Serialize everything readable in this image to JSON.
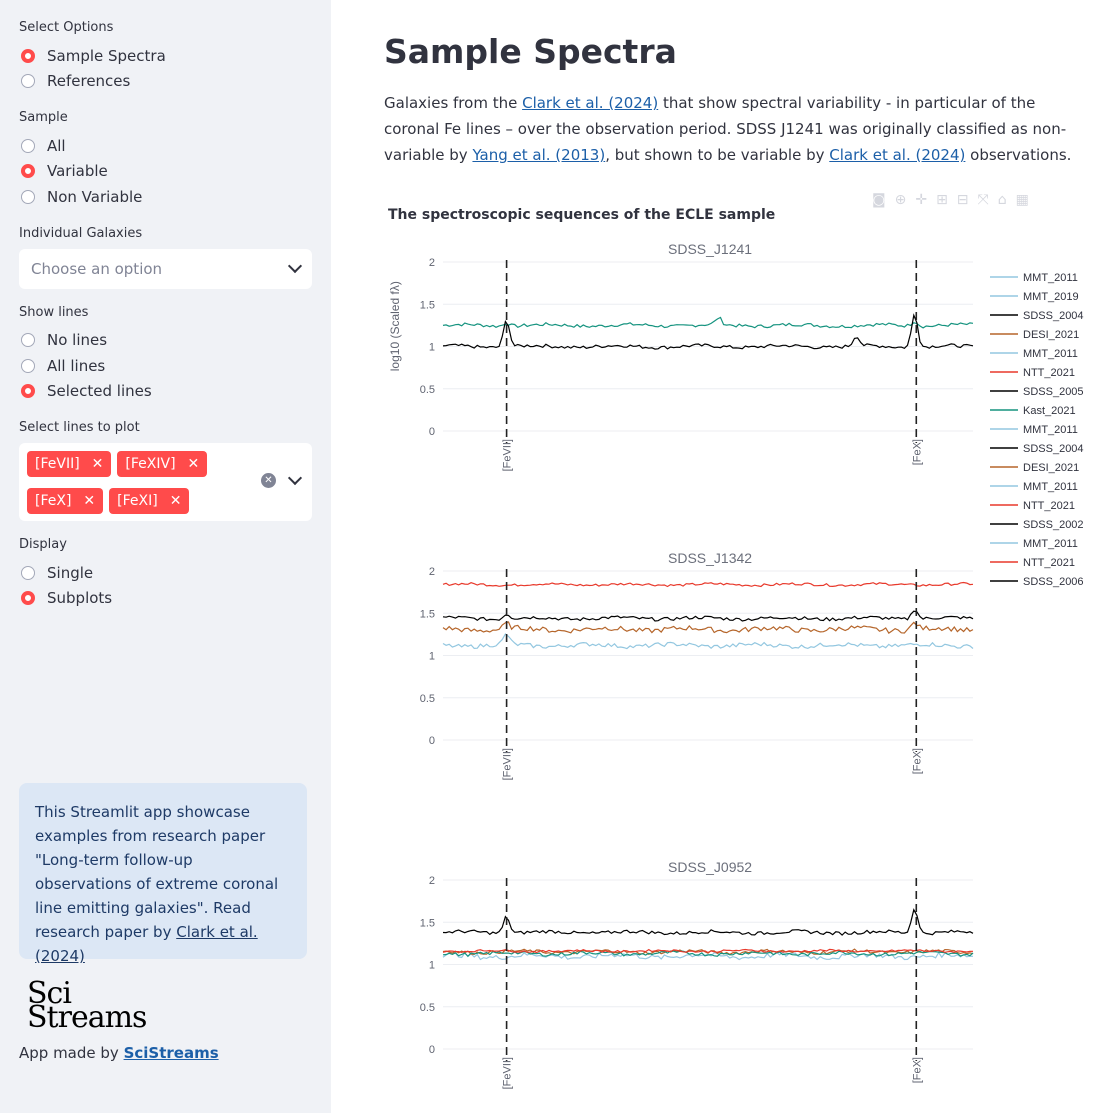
{
  "sidebar": {
    "select_options": {
      "label": "Select Options",
      "options": [
        "Sample Spectra",
        "References"
      ],
      "selected": 0
    },
    "sample": {
      "label": "Sample",
      "options": [
        "All",
        "Variable",
        "Non Variable"
      ],
      "selected": 1
    },
    "individual": {
      "label": "Individual Galaxies",
      "placeholder": "Choose an option"
    },
    "show_lines": {
      "label": "Show lines",
      "options": [
        "No lines",
        "All lines",
        "Selected lines"
      ],
      "selected": 2
    },
    "select_lines": {
      "label": "Select lines to plot",
      "tags": [
        "[FeVII]",
        "[FeXIV]",
        "[FeX]",
        "[FeXI]"
      ]
    },
    "display": {
      "label": "Display",
      "options": [
        "Single",
        "Subplots"
      ],
      "selected": 1
    },
    "info": {
      "text": "This Streamlit app showcase examples from research paper \"Long-term follow-up observations of extreme coronal line emitting galaxies\". Read research paper by ",
      "link": "Clark et al. (2024)"
    },
    "logo": {
      "line1": "Sci",
      "line2": "Streams"
    },
    "made_by": {
      "text": "App made by ",
      "link": "SciStreams"
    }
  },
  "main": {
    "title": "Sample Spectra",
    "desc_1": "Galaxies from the ",
    "link_1": "Clark et al. (2024)",
    "desc_2": " that show spectral variability - in particular of the coronal Fe lines – over the observation period. SDSS J1241 was originally classified as non-variable by ",
    "link_2": "Yang et al. (2013)",
    "desc_3": ", but shown to be variable by ",
    "link_3": "Clark et al. (2024)",
    "desc_4": " observations."
  },
  "colors": {
    "accent": "#ff4b4b",
    "sidebar_bg": "#f0f2f6",
    "info_bg": "#dce7f5"
  },
  "chart_data": {
    "type": "line",
    "title": "The spectroscopic sequences of the ECLE sample",
    "ylabel": "log10 (Scaled fλ)",
    "ylim": [
      0,
      2
    ],
    "yticks": [
      "2",
      "1.5",
      "1",
      "0.5",
      "0"
    ],
    "line_markers": [
      "[FeVII]",
      "[FeX]"
    ],
    "legend": [
      {
        "name": "MMT_2011",
        "color": "#93c7e0"
      },
      {
        "name": "MMT_2019",
        "color": "#93c7e0"
      },
      {
        "name": "SDSS_2004",
        "color": "#000000"
      },
      {
        "name": "DESI_2021",
        "color": "#b5652a"
      },
      {
        "name": "MMT_2011",
        "color": "#93c7e0"
      },
      {
        "name": "NTT_2021",
        "color": "#e8392b"
      },
      {
        "name": "SDSS_2005",
        "color": "#000000"
      },
      {
        "name": "Kast_2021",
        "color": "#15937f"
      },
      {
        "name": "MMT_2011",
        "color": "#93c7e0"
      },
      {
        "name": "SDSS_2004",
        "color": "#000000"
      },
      {
        "name": "DESI_2021",
        "color": "#b5652a"
      },
      {
        "name": "MMT_2011",
        "color": "#93c7e0"
      },
      {
        "name": "NTT_2021",
        "color": "#e8392b"
      },
      {
        "name": "SDSS_2002",
        "color": "#000000"
      },
      {
        "name": "MMT_2011",
        "color": "#93c7e0"
      },
      {
        "name": "NTT_2021",
        "color": "#e8392b"
      },
      {
        "name": "SDSS_2006",
        "color": "#000000"
      }
    ],
    "subplots": [
      {
        "title": "SDSS_J1241",
        "series": [
          {
            "color": "#15937f",
            "base": 1.25,
            "noise": 0.02,
            "peaks": [
              [
                0.52,
                0.08
              ],
              [
                0.12,
                0.04
              ],
              [
                0.89,
                0.06
              ]
            ]
          },
          {
            "color": "#000000",
            "base": 1.0,
            "noise": 0.02,
            "peaks": [
              [
                0.12,
                0.32
              ],
              [
                0.89,
                0.4
              ],
              [
                0.78,
                0.12
              ]
            ]
          }
        ]
      },
      {
        "title": "SDSS_J1342",
        "series": [
          {
            "color": "#e8392b",
            "base": 1.84,
            "noise": 0.015,
            "peaks": []
          },
          {
            "color": "#000000",
            "base": 1.44,
            "noise": 0.02,
            "peaks": [
              [
                0.12,
                0.06
              ],
              [
                0.89,
                0.12
              ]
            ]
          },
          {
            "color": "#b5652a",
            "base": 1.31,
            "noise": 0.03,
            "peaks": [
              [
                0.12,
                0.06
              ],
              [
                0.89,
                0.08
              ]
            ]
          },
          {
            "color": "#93c7e0",
            "base": 1.12,
            "noise": 0.025,
            "peaks": [
              [
                0.12,
                0.12
              ]
            ]
          }
        ]
      },
      {
        "title": "SDSS_J0952",
        "series": [
          {
            "color": "#000000",
            "base": 1.38,
            "noise": 0.02,
            "peaks": [
              [
                0.12,
                0.2
              ],
              [
                0.89,
                0.3
              ]
            ]
          },
          {
            "color": "#93c7e0",
            "base": 1.1,
            "noise": 0.03,
            "peaks": []
          },
          {
            "color": "#b5652a",
            "base": 1.15,
            "noise": 0.02,
            "peaks": []
          },
          {
            "color": "#15937f",
            "base": 1.13,
            "noise": 0.02,
            "peaks": []
          },
          {
            "color": "#e8392b",
            "base": 1.16,
            "noise": 0.012,
            "peaks": []
          }
        ]
      }
    ]
  }
}
